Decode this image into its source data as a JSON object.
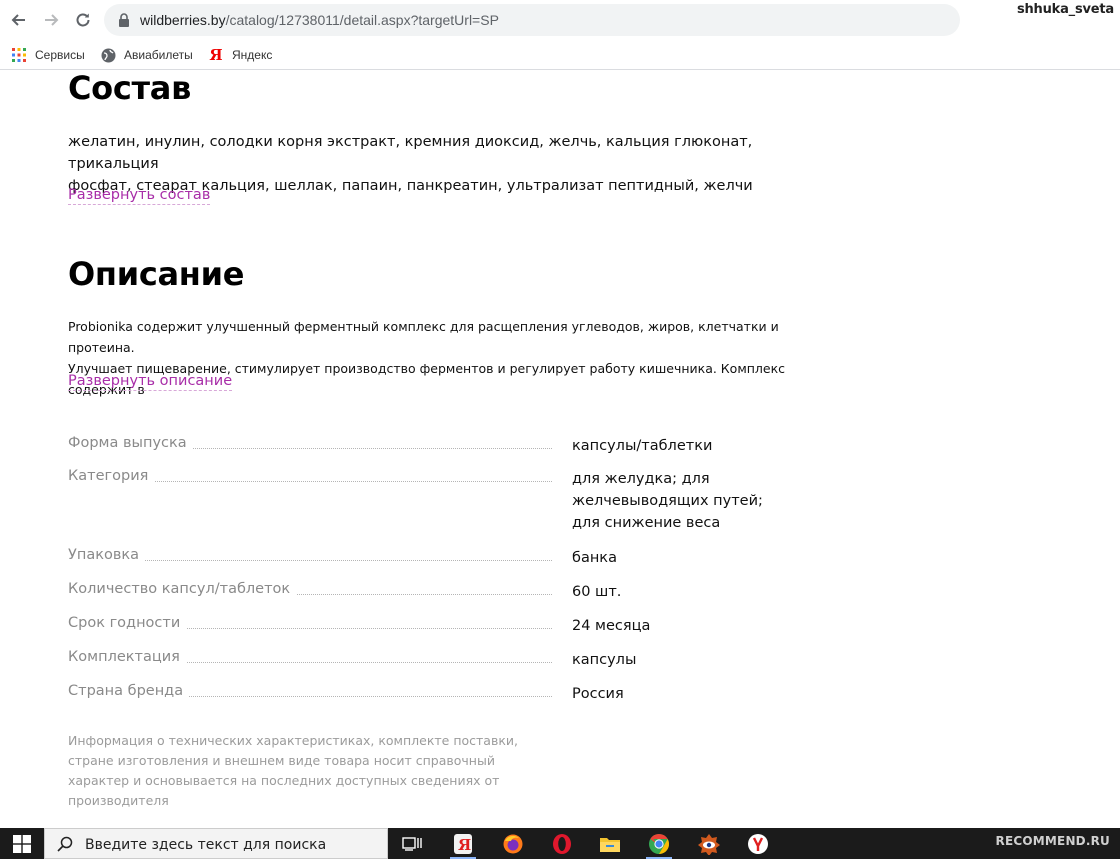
{
  "browser": {
    "url_host": "wildberries.by",
    "url_path": "/catalog/12738011/detail.aspx?targetUrl=SP",
    "profile_name": "shhuka_sveta",
    "bookmarks": [
      {
        "label": "Сервисы",
        "icon": "apps-grid-icon"
      },
      {
        "label": "Авиабилеты",
        "icon": "globe-icon"
      },
      {
        "label": "Яндекс",
        "icon": "yandex-icon"
      }
    ]
  },
  "composition": {
    "title": "Состав",
    "line1": "желатин, инулин, солодки корня экстракт, кремния диоксид, желчь, кальция глюконат, трикальция",
    "line2": "фосфат, стеарат кальция, шеллак, папаин, панкреатин, ультрализат пептидный, желчи",
    "expand_label": "Развернуть состав"
  },
  "description": {
    "title": "Описание",
    "line1": "Probionika содержит улучшенный ферментный комплекс для расщепления углеводов, жиров, клетчатки и протеина.",
    "line2": "Улучшает пищеварение, стимулирует производство ферментов и регулирует работу кишечника. Комплекс содержит в",
    "expand_label": "Развернуть описание"
  },
  "specs": [
    {
      "label": "Форма выпуска",
      "value": "капсулы/таблетки"
    },
    {
      "label": "Категория",
      "value": "для желудка; для желчевыводящих путей; для снижение веса"
    },
    {
      "label": "Упаковка",
      "value": "банка"
    },
    {
      "label": "Количество капсул/таблеток",
      "value": "60 шт."
    },
    {
      "label": "Срок годности",
      "value": "24 месяца"
    },
    {
      "label": "Комплектация",
      "value": "капсулы"
    },
    {
      "label": "Страна бренда",
      "value": "Россия"
    }
  ],
  "disclaimer": "Информация о технических характеристиках, комплекте поставки, стране изготовления и внешнем виде товара носит справочный характер и основывается на последних доступных сведениях от производителя",
  "taskbar": {
    "search_placeholder": "Введите здесь текст для поиска",
    "watermark": "RECOMMEND.RU",
    "colors": {
      "opera": "#e0182d",
      "chrome_red": "#ea4335",
      "chrome_yellow": "#fbbc05",
      "chrome_green": "#34a853",
      "chrome_blue": "#4285f4"
    }
  },
  "colors": {
    "link": "#a82ea8",
    "label_gray": "#8a8a8a"
  }
}
